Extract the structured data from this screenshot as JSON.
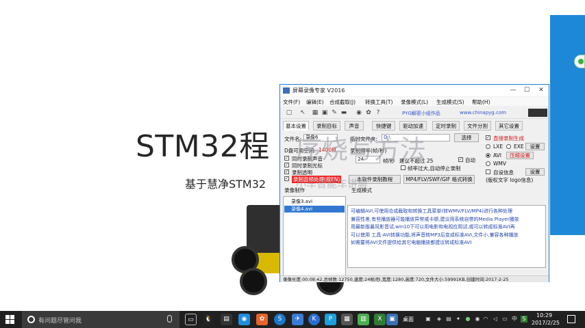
{
  "slide": {
    "title": "STM32程",
    "subtitle": "基于慧净STM32",
    "overlay_title": "序烧写方法",
    "overlay_subtitle": "小车智能车讲解"
  },
  "recorder": {
    "title": "屏幕录像专家 V2016",
    "menu": [
      "文件(F)",
      "编辑(E)",
      "合成截取(J)",
      "转换工具(T)",
      "录像模式(L)",
      "生成模式(S)",
      "帮助(H)"
    ],
    "toolbar_link1": "PYG解密小组作品",
    "toolbar_link2": "www.chinapyg.com",
    "tabs": [
      "基本设置",
      "录制目标",
      "声音",
      "快捷键",
      "驱动加速",
      "定时录制",
      "文件分割",
      "其它设置"
    ],
    "filename_label": "文件名:",
    "filename_value": "录像6",
    "tempfolder_label": "临时文件夹:",
    "tempfolder_value": "D:\\",
    "browse_button": "选择",
    "freespace_label": "D盘可用空间:",
    "freespace_value": "1400M",
    "record_fps_label": "录制频率(帧/秒)",
    "fps_value": "24",
    "fps_unit": "帧/秒",
    "suggest_label": "建议不超过 25",
    "auto_label": "自动",
    "fps_overflow_label": "帧率过大,自动停止录制",
    "checks": [
      "同时录制声音",
      "同时录制光标",
      "录制透明",
      "录制音频处理(按FN)"
    ],
    "direct_record": "直接录制生成",
    "radio_lxe": "LXE",
    "radio_exe": "EXE",
    "radio_avi": "AVI",
    "radio_wmv": "WMV",
    "set_button": "设置",
    "compress_button": "压缩设置",
    "auto_settings": "自设信息",
    "version_text": "(版权文字 logo信息)",
    "extract_button": "本软件录制教程",
    "format_convert_button": "MP4/FLV/SWF/GIF 格式转换",
    "list_header": "录像制作",
    "list_header2": "生成模式",
    "list_items": [
      "录像3.avi",
      "录像4.avi"
    ],
    "info_lines": [
      "可编辑AVI,可使用合成截取和转换工具菜单(转WMV/FLV/MP4)进行各种处理",
      "兼容性差,有些播放器可能播放异常或卡顿,建议用系统自带的Media Player播放",
      "    用最新版暴风影音试,win10下可以用电影和电视应用试,或可以转成标准AVI再",
      "可以使用 工具-AVI转换功能,将声音转MP3后变成标准AVI,文件小,兼容各种播放",
      "如需要将AVI文件提供给其它电脑播放都建议转成标准AVI"
    ],
    "status": "录像长度:00:08:42,总帧数:12750,速度:24帧/秒,宽度:1280,高度:720,文件大小:59991KB,创建时间:2017-2-25"
  },
  "taskbar": {
    "search_placeholder": "有问题尽管问我",
    "desktop_label": "桌面",
    "time": "10:29",
    "date": "2017/2/25"
  },
  "colors": {
    "taskbar_bg": "#202020",
    "accent_blue": "#1e88d8",
    "recorder_border": "#1d7cd6"
  }
}
